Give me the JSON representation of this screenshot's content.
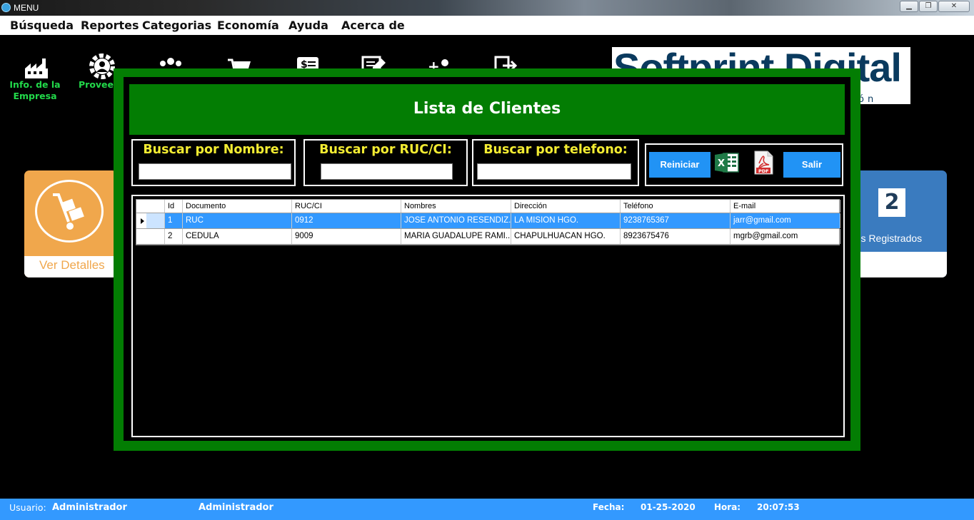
{
  "window": {
    "title": "MENU",
    "controls": [
      "minimize",
      "restore",
      "close"
    ]
  },
  "menu": {
    "items": [
      "Búsqueda",
      "Reportes",
      "Categorias",
      "Economía",
      "Ayuda",
      "Acerca de"
    ]
  },
  "toolbar": {
    "company_label_line1": "Info. de la",
    "company_label_line2": "Empresa",
    "providers_label": "Proveed"
  },
  "logo": {
    "text": "Softprint Digital",
    "subtext": "ón"
  },
  "cards": {
    "left_label": "Ver Detalles",
    "right_count": "2",
    "right_label": "rios Registrados"
  },
  "dialog": {
    "title": "Lista de Clientes",
    "search_name_label": "Buscar por Nombre:",
    "search_ruc_label": "Buscar por RUC/CI:",
    "search_phone_label": "Buscar por telefono:",
    "search_name_value": "",
    "search_ruc_value": "",
    "search_phone_value": "",
    "reset_label": "Reiniciar",
    "exit_label": "Salir",
    "excel_icon": "excel-icon",
    "pdf_icon": "pdf-icon"
  },
  "grid": {
    "columns": [
      "Id",
      "Documento",
      "RUC/CI",
      "Nombres",
      "Dirección",
      "Teléfono",
      "E-mail"
    ],
    "rows": [
      [
        "1",
        "RUC",
        "0912",
        "JOSE ANTONIO RESENDIZ...",
        "LA MISION HGO.",
        "9238765367",
        "jarr@gmail.com"
      ],
      [
        "2",
        "CEDULA",
        "9009",
        "MARIA GUADALUPE RAMI...",
        "CHAPULHUACAN HGO.",
        "8923675476",
        "mgrb@gmail.com"
      ]
    ],
    "selected_row": 0
  },
  "status": {
    "user_label": "Usuario:",
    "user_value": "Administrador",
    "role_value": "Administrador",
    "date_label": "Fecha:",
    "date_value": "01-25-2020",
    "time_label": "Hora:",
    "time_value": "20:07:53"
  },
  "colors": {
    "dialog_green": "#037d03",
    "label_yellow": "#f3ec32",
    "button_blue": "#2193f5",
    "status_blue": "#3399ff",
    "toolbar_label_green": "#22d94a"
  }
}
